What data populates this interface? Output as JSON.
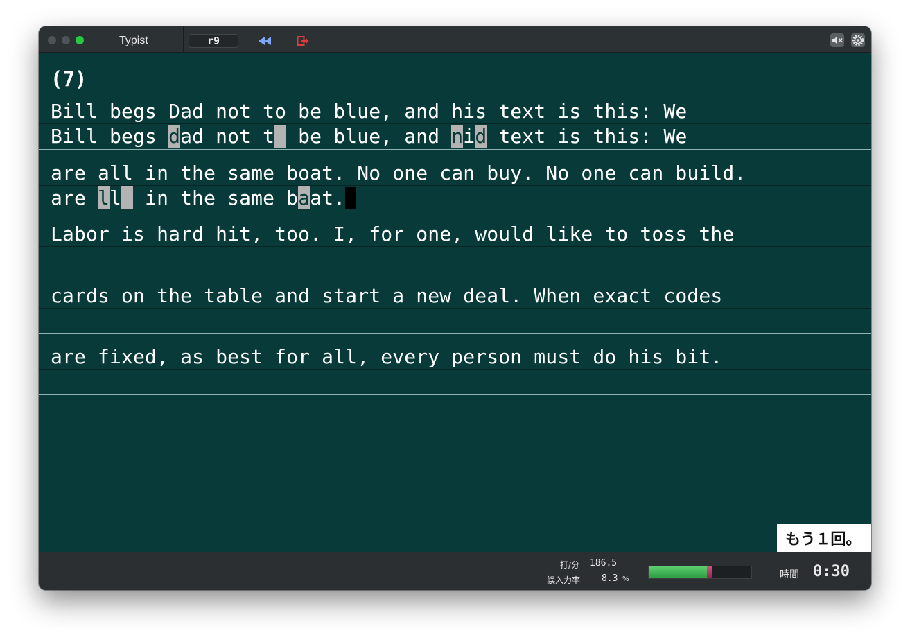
{
  "window": {
    "title": "Typist",
    "level": "r9"
  },
  "exercise": {
    "number": "(7)",
    "rows": [
      {
        "prompt": "Bill begs Dad not to be blue, and his text is this: We",
        "typed_segments": [
          {
            "text": "Bill begs ",
            "error": false
          },
          {
            "text": "d",
            "error": true
          },
          {
            "text": "ad not t",
            "error": false
          },
          {
            "text": " ",
            "error": true
          },
          {
            "text": " be blue, and ",
            "error": false
          },
          {
            "text": "n",
            "error": true
          },
          {
            "text": "i",
            "error": false
          },
          {
            "text": "d",
            "error": true
          },
          {
            "text": " text is this: We",
            "error": false
          }
        ],
        "cursor": false
      },
      {
        "prompt": "are all in the same boat. No one can buy. No one can build.",
        "typed_segments": [
          {
            "text": "are ",
            "error": false
          },
          {
            "text": "l",
            "error": true
          },
          {
            "text": "l",
            "error": false
          },
          {
            "text": " ",
            "error": true
          },
          {
            "text": " in the same b",
            "error": false
          },
          {
            "text": "a",
            "error": true
          },
          {
            "text": "at.",
            "error": false
          }
        ],
        "cursor": true
      },
      {
        "prompt": "Labor is hard hit, too. I, for one, would like to toss the",
        "typed_segments": [],
        "cursor": false
      },
      {
        "prompt": "cards on the table and start a new deal. When exact codes",
        "typed_segments": [],
        "cursor": false
      },
      {
        "prompt": "are fixed, as best for all, every person must do his bit.",
        "typed_segments": [],
        "cursor": false
      }
    ]
  },
  "retry_button": {
    "label": "もう１回。"
  },
  "stats": {
    "speed_label": "打/分",
    "speed_value": "186.5",
    "error_rate_label": "誤入力率",
    "error_rate_value": "8.3",
    "error_rate_unit": "%",
    "progress_correct_fraction": 0.57,
    "progress_error_fraction": 0.05,
    "time_label": "時間",
    "time_value": "0:30"
  },
  "colors": {
    "background": "#073a38",
    "error_highlight": "#b3b3b3",
    "cursor": "#000000",
    "progress_correct": "#3fb557",
    "progress_error": "#b43a68"
  },
  "icons": {
    "rewind": "rewind-icon",
    "exit": "exit-icon",
    "mute": "speaker-mute-icon",
    "settings": "gear-icon"
  }
}
